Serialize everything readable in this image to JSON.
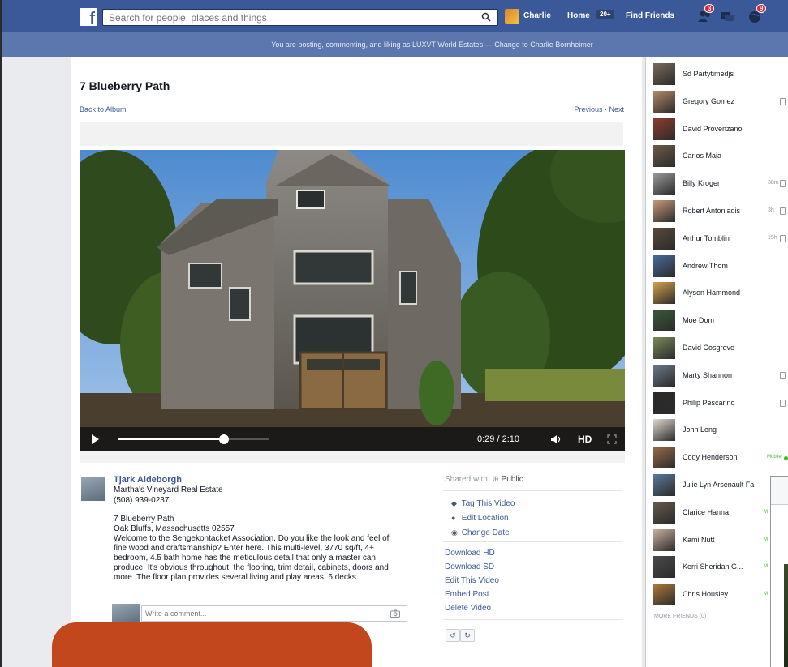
{
  "header": {
    "search_placeholder": "Search for people, places and things",
    "profile_name": "Charlie",
    "home_label": "Home",
    "home_badge": "20+",
    "find_friends_label": "Find Friends",
    "friend_requests_count": "3",
    "notifications_count": "9"
  },
  "notice": "You are posting, commenting, and liking as LUXVT World Estates — Change to Charlie Bornheimer",
  "photo": {
    "title": "7 Blueberry Path",
    "back_link": "Back to Album",
    "prev_next": "Previous · Next"
  },
  "video": {
    "progress": 0.7,
    "time": "0:29 / 2:10",
    "hd_label": "HD"
  },
  "poster": {
    "name": "Tjark Aldeborgh",
    "company": "Martha's Vineyard Real Estate",
    "phone": "(508) 939-0237",
    "address_line1": "7 Blueberry Path",
    "address_line2": "Oak Bluffs, Massachusetts 02557",
    "description": "Welcome to the Sengekontacket Association. Do you like the look and feel of fine wood and craftsmanship? Enter here. This multi-level, 3770 sq/ft, 4+ bedroom, 4.5 bath home has the meticulous detail that only a master can produce. It's obvious throughout; the flooring, trim detail, cabinets, doors and more. The floor plan provides several living and play areas, 6 decks"
  },
  "comment": {
    "placeholder": "Write a comment..."
  },
  "sidebar_actions": {
    "shared_with_label": "Shared with:",
    "shared_with_value": "Public",
    "tag": "Tag This Video",
    "edit_location": "Edit Location",
    "change_date": "Change Date",
    "download_hd": "Download HD",
    "download_sd": "Download SD",
    "edit_video": "Edit This Video",
    "embed_post": "Embed Post",
    "delete_video": "Delete Video"
  },
  "friends": [
    {
      "name": "Sd Partytimedjs",
      "meta": ""
    },
    {
      "name": "Gregory Gomez",
      "meta": ""
    },
    {
      "name": "David Provenzano",
      "meta": ""
    },
    {
      "name": "Carlos Maia",
      "meta": ""
    },
    {
      "name": "Billy Kroger",
      "meta": "38m"
    },
    {
      "name": "Robert Antoniadis",
      "meta": "3h"
    },
    {
      "name": "Arthur Tomblin",
      "meta": "15h"
    },
    {
      "name": "Andrew Thom",
      "meta": ""
    },
    {
      "name": "Alyson Hammond",
      "meta": ""
    },
    {
      "name": "Moe Dom",
      "meta": ""
    },
    {
      "name": "David Cosgrove",
      "meta": ""
    },
    {
      "name": "Marty Shannon",
      "meta": ""
    },
    {
      "name": "Philip Pescarino",
      "meta": ""
    },
    {
      "name": "John Long",
      "meta": ""
    },
    {
      "name": "Cody Henderson",
      "meta": "Mobile"
    },
    {
      "name": "Julie Lyn Arsenault Fa",
      "meta": ""
    },
    {
      "name": "Clarice Hanna",
      "meta": "M"
    },
    {
      "name": "Kami Nutt",
      "meta": "M"
    },
    {
      "name": "Kerri Sheridan G...",
      "meta": "M"
    },
    {
      "name": "Chris Housley",
      "meta": "M"
    }
  ],
  "more_friends": "MORE FRIENDS (0)",
  "colors": {
    "brand": "#3b5998",
    "notice_bar": "#5b77ad",
    "promo": "#c3471c"
  }
}
